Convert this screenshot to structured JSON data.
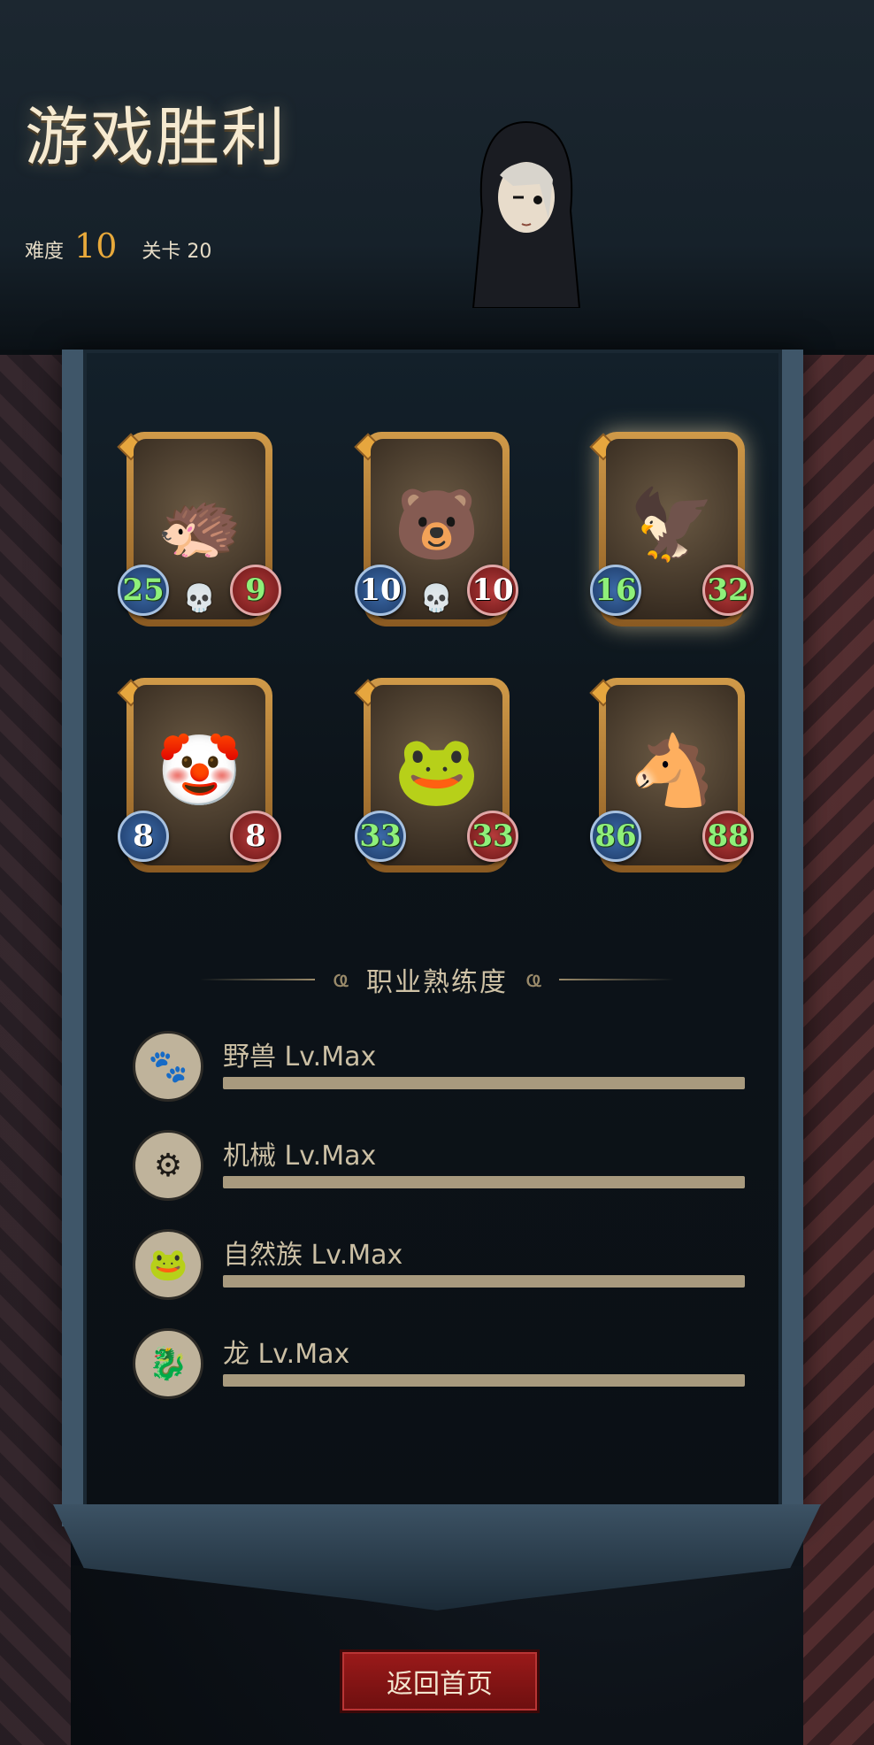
{
  "header": {
    "title": "游戏胜利",
    "difficulty_label": "难度",
    "difficulty_value": "10",
    "stage_text": "关卡 20"
  },
  "cards": [
    {
      "creature": "hedgehog-bandit",
      "glyph": "🦔",
      "attack": "25",
      "health": "9",
      "attack_buffed": true,
      "health_buffed": true,
      "skull": true,
      "highlight": false
    },
    {
      "creature": "fire-bear",
      "glyph": "🐻",
      "attack": "10",
      "health": "10",
      "attack_buffed": false,
      "health_buffed": false,
      "skull": true,
      "highlight": false
    },
    {
      "creature": "white-eagle",
      "glyph": "🦅",
      "attack": "16",
      "health": "32",
      "attack_buffed": true,
      "health_buffed": true,
      "skull": false,
      "highlight": true
    },
    {
      "creature": "clown",
      "glyph": "🤡",
      "attack": "8",
      "health": "8",
      "attack_buffed": false,
      "health_buffed": false,
      "skull": false,
      "highlight": false
    },
    {
      "creature": "frog",
      "glyph": "🐸",
      "attack": "33",
      "health": "33",
      "attack_buffed": true,
      "health_buffed": true,
      "skull": false,
      "highlight": false
    },
    {
      "creature": "dark-horse",
      "glyph": "🐴",
      "attack": "86",
      "health": "88",
      "attack_buffed": true,
      "health_buffed": true,
      "skull": false,
      "highlight": false
    }
  ],
  "mastery": {
    "title": "职业熟练度",
    "items": [
      {
        "label": "野兽 Lv.Max",
        "icon": "beast-claw-icon",
        "glyph": "🐾",
        "progress": 1.0
      },
      {
        "label": "机械 Lv.Max",
        "icon": "mechanical-icon",
        "glyph": "⚙",
        "progress": 1.0
      },
      {
        "label": "自然族 Lv.Max",
        "icon": "nature-icon",
        "glyph": "🐸",
        "progress": 1.0
      },
      {
        "label": "龙 Lv.Max",
        "icon": "dragon-icon",
        "glyph": "🐉",
        "progress": 1.0
      }
    ]
  },
  "footer": {
    "home_button": "返回首页"
  },
  "colors": {
    "accent_gold": "#e8a93b",
    "buff_green": "#8ff07a",
    "button_red": "#9b1a1a"
  }
}
